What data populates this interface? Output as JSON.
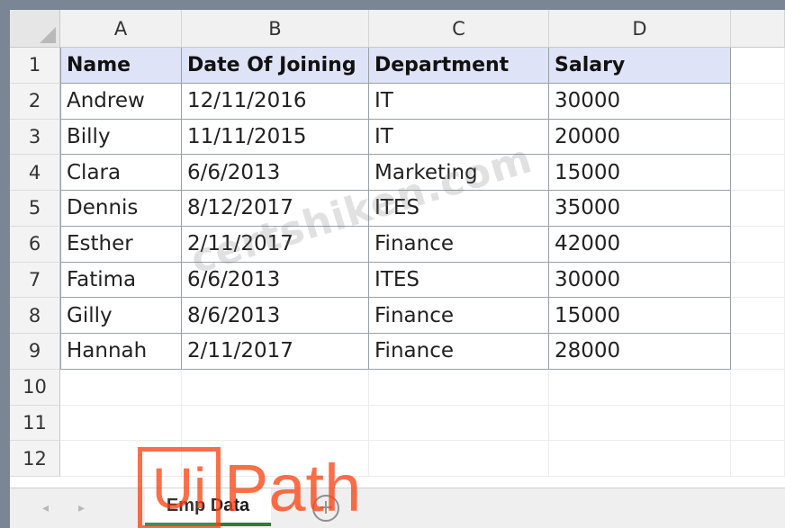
{
  "spreadsheet": {
    "column_headers": [
      "A",
      "B",
      "C",
      "D"
    ],
    "row_numbers": [
      "1",
      "2",
      "3",
      "4",
      "5",
      "6",
      "7",
      "8",
      "9",
      "10",
      "11",
      "12"
    ],
    "rows": [
      [
        "Name",
        "Date Of Joining",
        "Department",
        "Salary"
      ],
      [
        "Andrew",
        "12/11/2016",
        "IT",
        "30000"
      ],
      [
        "Billy",
        "11/11/2015",
        "IT",
        "20000"
      ],
      [
        "Clara",
        "6/6/2013",
        "Marketing",
        "15000"
      ],
      [
        "Dennis",
        "8/12/2017",
        "ITES",
        "35000"
      ],
      [
        "Esther",
        "2/11/2017",
        "Finance",
        "42000"
      ],
      [
        "Fatima",
        "6/6/2013",
        "ITES",
        "30000"
      ],
      [
        "Gilly",
        "8/6/2013",
        "Finance",
        "15000"
      ],
      [
        "Hannah",
        "2/11/2017",
        "Finance",
        "28000"
      ]
    ],
    "header_fill_color": "#dfe3f7"
  },
  "tabs": {
    "active_sheet": "Emp Data",
    "add_symbol": "+",
    "nav_prev": "◂",
    "nav_next": "▸"
  },
  "overlays": {
    "watermark_text": "certshiken.com",
    "logo_box_text": "Ui",
    "logo_text": "Path",
    "logo_color": "#fa4616"
  }
}
